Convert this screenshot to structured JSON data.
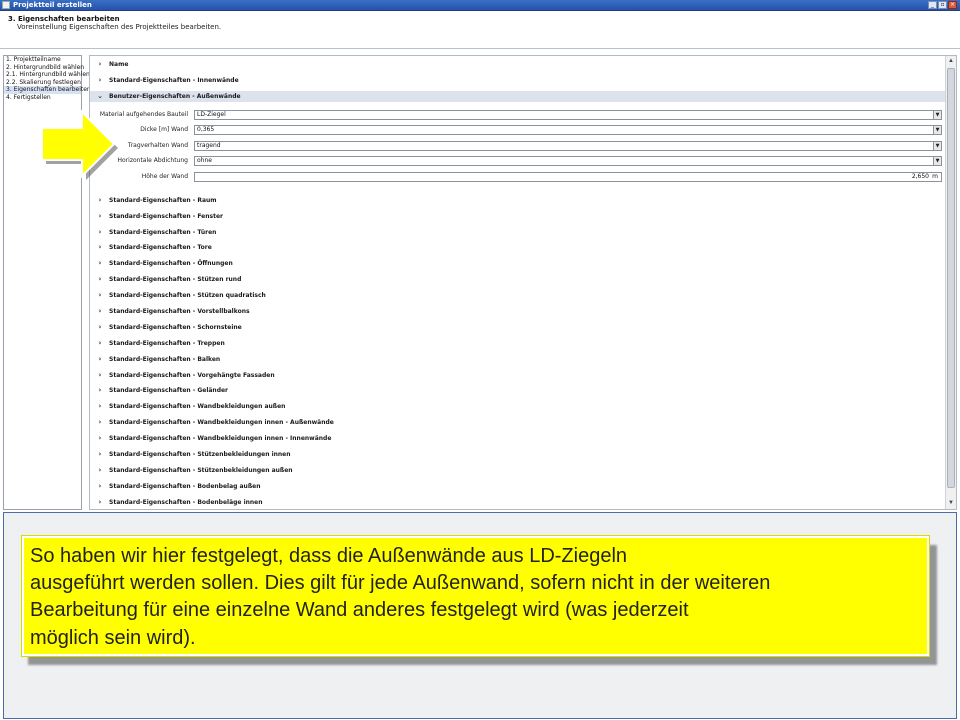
{
  "window": {
    "title": "Projektteil erstellen",
    "controls": {
      "minimize": "_",
      "maximize": "▫",
      "close": "×"
    }
  },
  "header": {
    "title": "3. Eigenschaften bearbeiten",
    "subtitle": "Voreinstellung Eigenschaften des Projektteiles bearbeiten."
  },
  "steps": [
    {
      "label": "1. Projektteilname"
    },
    {
      "label": "2. Hintergrundbild wählen"
    },
    {
      "label": "2.1. Hintergrundbild wählen"
    },
    {
      "label": "2.2. Skalierung festlegen"
    },
    {
      "label": "3. Eigenschaften bearbeiten"
    },
    {
      "label": "4. Fertigstellen"
    }
  ],
  "sections_top": [
    {
      "label": "Name"
    },
    {
      "label": "Standard-Eigenschaften - Innenwände"
    }
  ],
  "expanded_section": {
    "label": "Benutzer-Eigenschaften - Außenwände",
    "properties": [
      {
        "label": "Material aufgehendes Bauteil",
        "value": "LD-Ziegel"
      },
      {
        "label": "Dicke [m] Wand",
        "value": "0,365"
      },
      {
        "label": "Tragverhalten Wand",
        "value": "tragend"
      },
      {
        "label": "Horizontale Abdichtung",
        "value": "ohne"
      },
      {
        "label": "Höhe der Wand",
        "value": "2,650",
        "unit": "m"
      }
    ]
  },
  "sections_bottom": [
    {
      "label": "Standard-Eigenschaften - Raum"
    },
    {
      "label": "Standard-Eigenschaften - Fenster"
    },
    {
      "label": "Standard-Eigenschaften - Türen"
    },
    {
      "label": "Standard-Eigenschaften - Tore"
    },
    {
      "label": "Standard-Eigenschaften - Öffnungen"
    },
    {
      "label": "Standard-Eigenschaften - Stützen rund"
    },
    {
      "label": "Standard-Eigenschaften - Stützen quadratisch"
    },
    {
      "label": "Standard-Eigenschaften - Vorstellbalkons"
    },
    {
      "label": "Standard-Eigenschaften - Schornsteine"
    },
    {
      "label": "Standard-Eigenschaften - Treppen"
    },
    {
      "label": "Standard-Eigenschaften - Balken"
    },
    {
      "label": "Standard-Eigenschaften - Vorgehängte Fassaden"
    },
    {
      "label": "Standard-Eigenschaften - Geländer"
    },
    {
      "label": "Standard-Eigenschaften - Wandbekleidungen außen"
    },
    {
      "label": "Standard-Eigenschaften - Wandbekleidungen innen - Außenwände"
    },
    {
      "label": "Standard-Eigenschaften - Wandbekleidungen innen - Innenwände"
    },
    {
      "label": "Standard-Eigenschaften - Stützenbekleidungen innen"
    },
    {
      "label": "Standard-Eigenschaften - Stützenbekleidungen außen"
    },
    {
      "label": "Standard-Eigenschaften - Bodenbelag außen"
    },
    {
      "label": "Standard-Eigenschaften - Bodenbeläge innen"
    }
  ],
  "callout": {
    "lines": [
      "So haben wir hier festgelegt, dass die Außenwände aus LD-Ziegeln",
      "ausgeführt werden sollen. Dies gilt für jede Außenwand, sofern nicht in der weiteren",
      "Bearbeitung für eine einzelne Wand anderes festgelegt wird (was jederzeit",
      "möglich sein wird)."
    ]
  },
  "colors": {
    "callout_bg": "#ffff00",
    "titlebar": "#2f61bb",
    "expanded_header": "#dde3ec"
  }
}
